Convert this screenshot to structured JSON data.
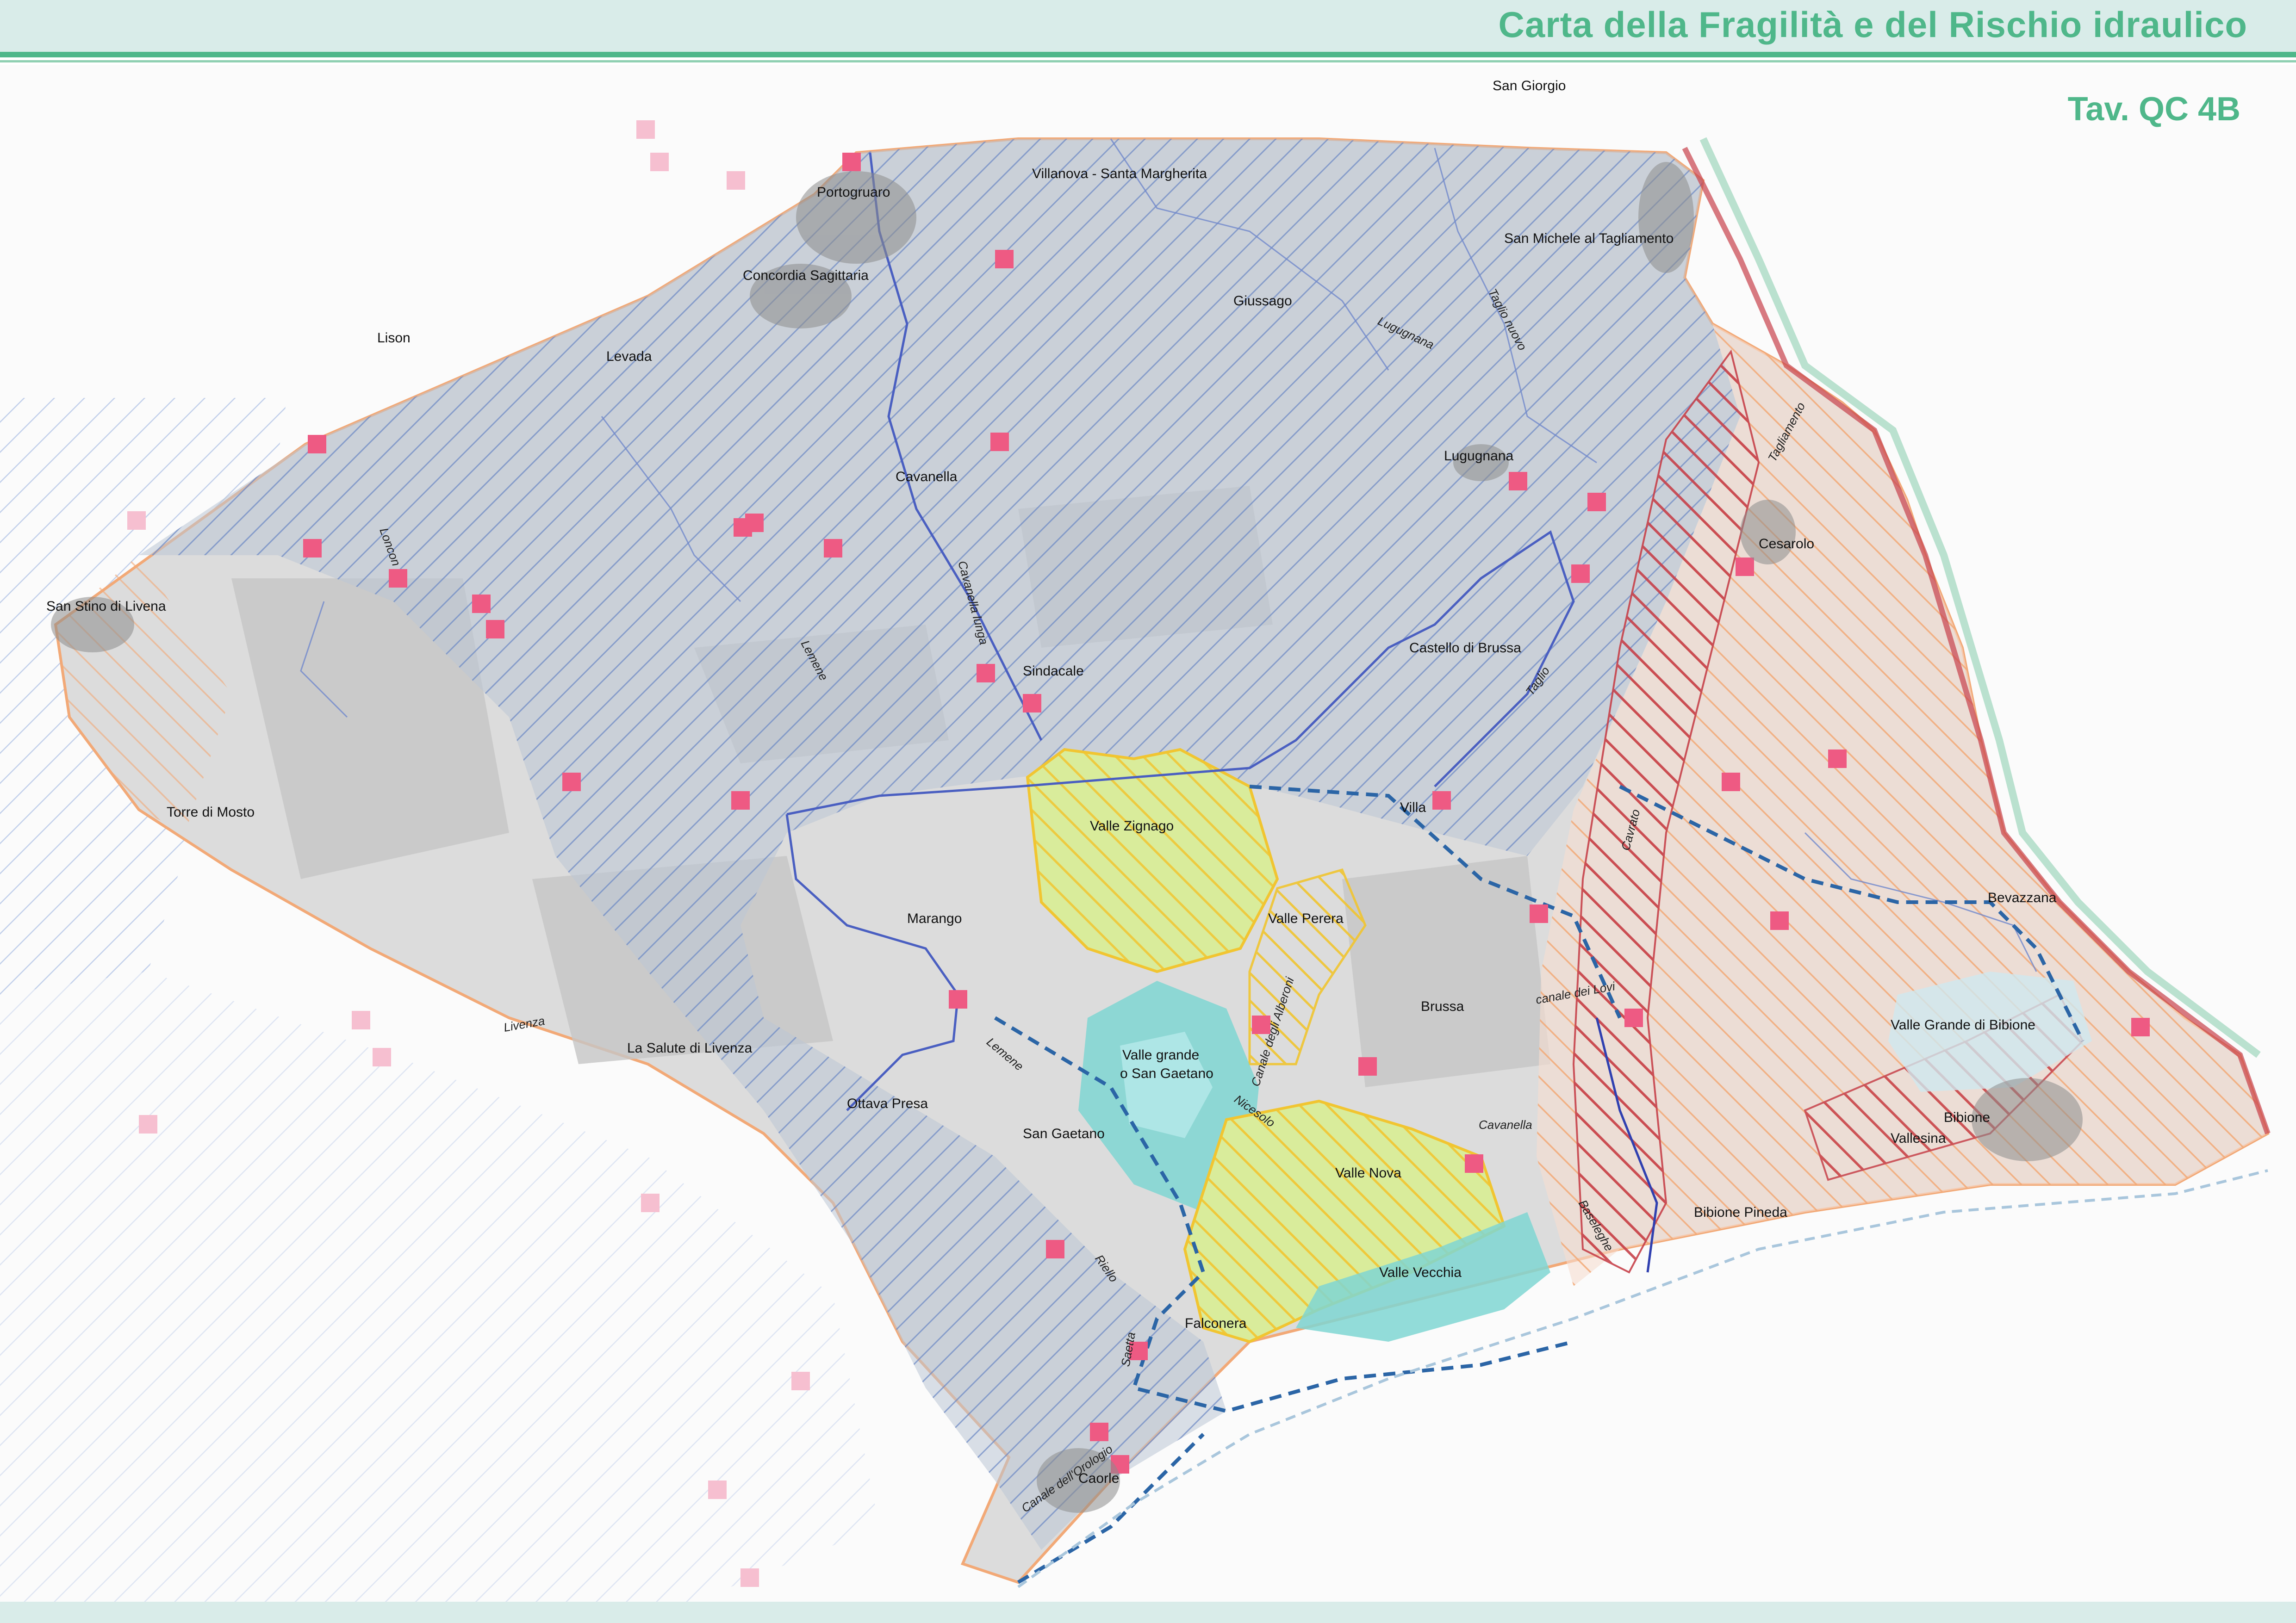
{
  "header": {
    "title": "Carta della Fragilità e del Rischio idraulico",
    "sheet_code": "Tav. QC 4B"
  },
  "colors": {
    "accent": "#4fb78a",
    "header_bg": "#d9ece9",
    "hazard_blue": "#6a87c4",
    "hazard_orange": "#f2a977",
    "hazard_red": "#c7424b",
    "valle_yellow": "#f1c531",
    "lagoon_cyan": "#7fd6d2",
    "marker_pink": "#ee5a83"
  },
  "places": {
    "san_giorgio": "San Giorgio",
    "portogruaro": "Portogruaro",
    "villanova": "Villanova - Santa Margherita",
    "san_michele": "San Michele al Tagliamento",
    "lison": "Lison",
    "levada": "Levada",
    "concordia": "Concordia Sagittaria",
    "giussago": "Giussago",
    "lugugnana": "Lugugnana",
    "cavanella": "Cavanella",
    "san_stino": "San Stino di Livena",
    "cesarolo": "Cesarolo",
    "castello_brussa": "Castello di Brussa",
    "sindacale": "Sindacale",
    "torre_mosto": "Torre di Mosto",
    "villa": "Villa",
    "marango": "Marango",
    "bevazzana": "Bevazzana",
    "brussa": "Brussa",
    "la_salute": "La Salute di Livenza",
    "ottava_presa": "Ottava Presa",
    "san_gaetano": "San Gaetano",
    "vallesina": "Vallesina",
    "bibione": "Bibione",
    "bibione_pineda": "Bibione Pineda",
    "falconera": "Falconera",
    "caorle": "Caorle",
    "cavanella_south": "Cavanella"
  },
  "valli": {
    "zignago": "Valle Zignago",
    "perera": "Valle Perera",
    "grande_line1": "Valle grande",
    "grande_line2": "o San Gaetano",
    "nova": "Valle Nova",
    "vecchia": "Valle Vecchia",
    "grande_bibione": "Valle Grande di Bibione"
  },
  "waterways": {
    "lugugnana_canal": "Lugugnana",
    "taglio_nuovo": "Taglio nuovo",
    "tagliamento": "Tagliamento",
    "lemene": "Lemene",
    "loncon": "Loncon",
    "cavanella_lunga": "Cavanella lunga",
    "taglio": "Taglio",
    "cavrato": "Cavrato",
    "canale_alberoni": "Canale degli Alberoni",
    "canale_lovi": "canale dei Lovi",
    "livenza": "Livenza",
    "lemene_south": "Lemene",
    "nicesolo": "Nicesolo",
    "riello": "Riello",
    "saetta": "Saetta",
    "baseleghe": "Baseleghe",
    "canale_orologio": "Canale dell'Orologio"
  }
}
